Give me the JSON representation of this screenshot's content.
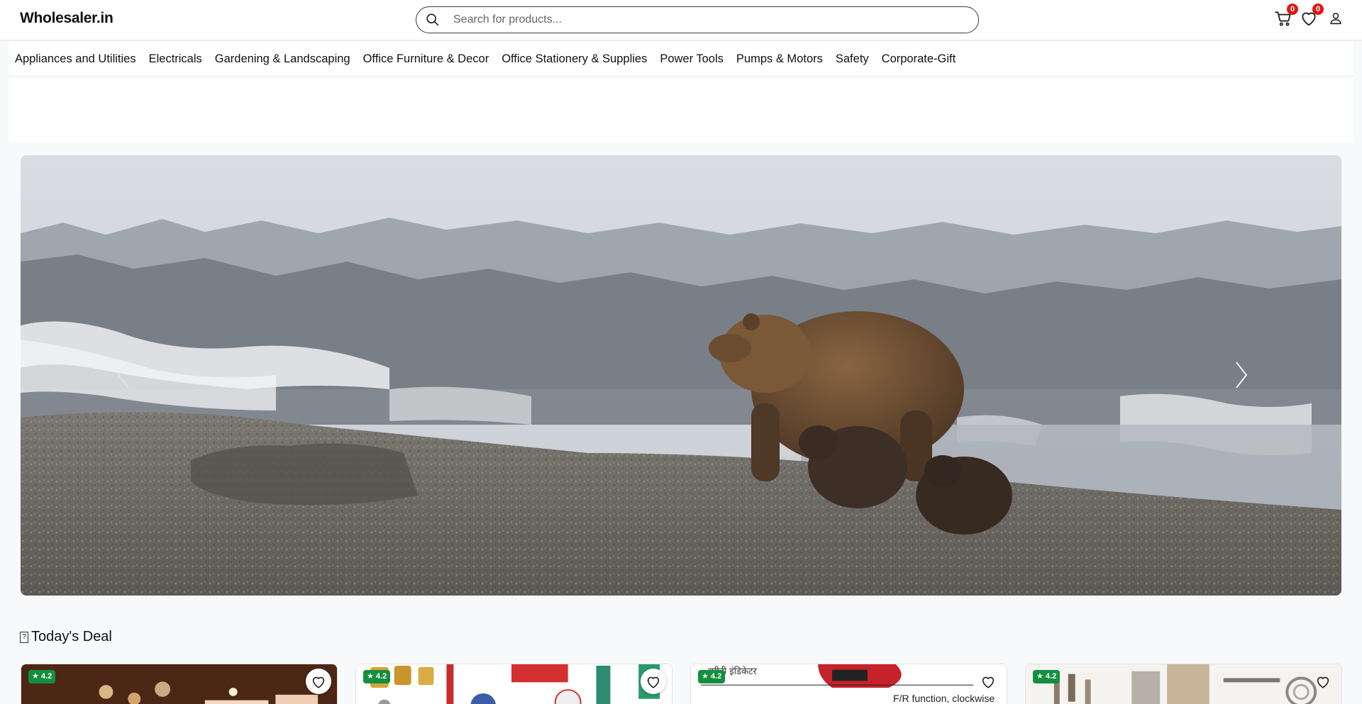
{
  "header": {
    "logo": "Wholesaler.in",
    "search_placeholder": "Search for products...",
    "cart_count": "0",
    "wishlist_count": "0"
  },
  "categories": [
    "Appliances and Utilities",
    "Electricals",
    "Gardening & Landscaping",
    "Office Furniture & Decor",
    "Office Stationery & Supplies",
    "Power Tools",
    "Pumps & Motors",
    "Safety",
    "Corporate-Gift"
  ],
  "deals": {
    "title": "Today's Deal",
    "cards": [
      {
        "rating": "4.2"
      },
      {
        "rating": "4.2"
      },
      {
        "rating": "4.2",
        "image_text_1": "स्पीडी इंडिकेटर",
        "image_text_2": "F/R function, clockwise"
      },
      {
        "rating": "4.2"
      }
    ]
  },
  "colors": {
    "badge": "#e01616",
    "rating": "#138f3f",
    "page_bg": "#f7f9fb"
  },
  "icons": [
    "search-icon",
    "cart-icon",
    "heart-icon",
    "user-icon",
    "chevron-left-icon",
    "chevron-right-icon",
    "star-icon"
  ]
}
